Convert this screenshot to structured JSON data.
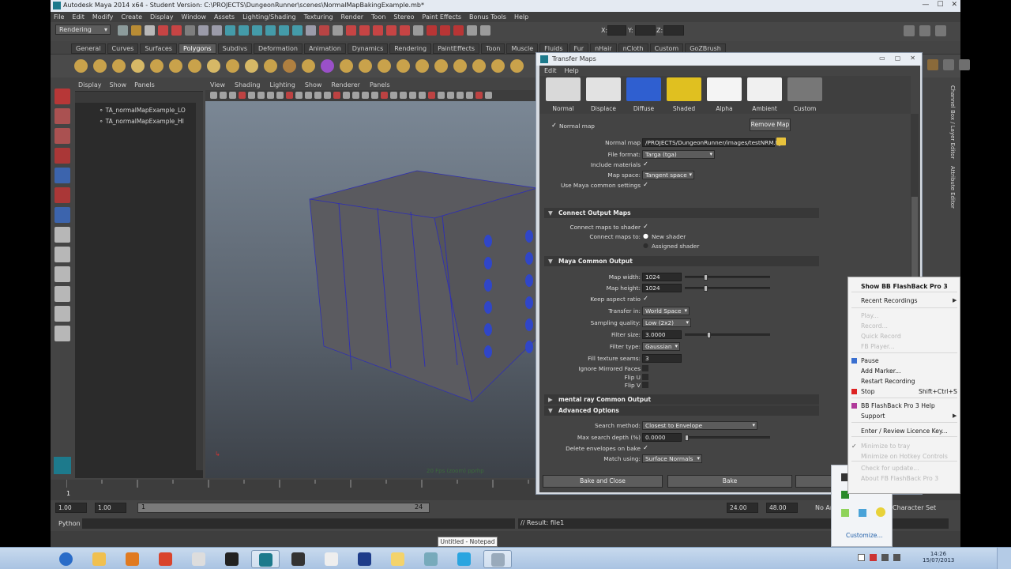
{
  "window": {
    "title": "Autodesk Maya 2014 x64 - Student Version: C:\\PROJECTS\\DungeonRunner\\scenes\\NormalMapBakingExample.mb*",
    "controls": [
      "—",
      "☐",
      "✕"
    ]
  },
  "menubar": [
    "File",
    "Edit",
    "Modify",
    "Create",
    "Display",
    "Window",
    "Assets",
    "Lighting/Shading",
    "Texturing",
    "Render",
    "Toon",
    "Stereo",
    "Paint Effects",
    "Bonus Tools",
    "Help"
  ],
  "statusline": {
    "mode": "Rendering",
    "x_label": "X:",
    "y_label": "Y:",
    "z_label": "Z:"
  },
  "shelf_tabs": [
    "General",
    "Curves",
    "Surfaces",
    "Polygons",
    "Subdivs",
    "Deformation",
    "Animation",
    "Dynamics",
    "Rendering",
    "PaintEffects",
    "Toon",
    "Muscle",
    "Fluids",
    "Fur",
    "nHair",
    "nCloth",
    "Custom",
    "GoZBrush"
  ],
  "shelf_active": "Polygons",
  "outliner": {
    "menu": [
      "Display",
      "Show",
      "Panels"
    ],
    "items": [
      "TA_normalMapExample_LO",
      "TA_normalMapExample_HI"
    ]
  },
  "viewport": {
    "menu": [
      "View",
      "Shading",
      "Lighting",
      "Show",
      "Renderer",
      "Panels"
    ],
    "hud": "20 Fps (zoom) pprhp",
    "colors": {
      "cube_face": "#5b5b60",
      "cube_top": "#5a5a5f",
      "edge": "#3030b0",
      "stud": "#3046c8"
    }
  },
  "right_strip": [
    "Channel Box / Layer Editor",
    "Attribute Editor"
  ],
  "timeline": {
    "tick_start": "1",
    "tick_end": "24"
  },
  "range": {
    "start": "1.00",
    "start2": "1.00",
    "range_start": "1",
    "range_end": "24",
    "end": "24.00",
    "end2": "48.00",
    "anim_layer": "No Anim Layer",
    "char_set": "Character Set"
  },
  "command": {
    "label": "Python",
    "result": "// Result: file1"
  },
  "transfer_maps": {
    "title": "Transfer Maps",
    "menu": [
      "Edit",
      "Help"
    ],
    "thumbs": [
      {
        "label": "Normal",
        "color": "#d9d9d9"
      },
      {
        "label": "Displace",
        "color": "#e2e2e2"
      },
      {
        "label": "Diffuse",
        "color": "#2f5fd0"
      },
      {
        "label": "Shaded",
        "color": "#e0c020"
      },
      {
        "label": "Alpha",
        "color": "#f4f4f4"
      },
      {
        "label": "Ambient",
        "color": "#f0f0f0"
      },
      {
        "label": "Custom",
        "color": "#777"
      }
    ],
    "normal_map": {
      "checkbox_label": "Normal map",
      "remove_button": "Remove Map",
      "path_label": "Normal map",
      "path": "/PROJECTS/DungeonRunner/images/testNRM.tga",
      "format_label": "File format:",
      "format": "Targa (tga)",
      "include_materials": "Include materials",
      "map_space_label": "Map space:",
      "map_space": "Tangent space",
      "use_common": "Use Maya common settings"
    },
    "connect": {
      "section": "Connect Output Maps",
      "connect_to_shader": "Connect maps to shader",
      "connect_to_label": "Connect maps to:",
      "new_shader": "New shader",
      "assigned_shader": "Assigned shader"
    },
    "common": {
      "section": "Maya Common Output",
      "width_label": "Map width:",
      "width": "1024",
      "height_label": "Map height:",
      "height": "1024",
      "keep_aspect": "Keep aspect ratio",
      "transfer_in_label": "Transfer in:",
      "transfer_in": "World Space",
      "sampling_label": "Sampling quality:",
      "sampling": "Low (2x2)",
      "filter_size_label": "Filter size:",
      "filter_size": "3.0000",
      "filter_type_label": "Filter type:",
      "filter_type": "Gaussian",
      "fill_label": "Fill texture seams:",
      "fill": "3",
      "ignore_mirrored": "Ignore Mirrored Faces",
      "flip_u": "Flip U",
      "flip_v": "Flip V"
    },
    "mental_ray": {
      "section": "mental ray Common Output"
    },
    "advanced": {
      "section": "Advanced Options",
      "search_label": "Search method:",
      "search": "Closest to Envelope",
      "depth_label": "Max search depth (%)",
      "depth": "0.0000",
      "delete_env": "Delete envelopes on bake",
      "match_label": "Match using:",
      "match": "Surface Normals"
    },
    "buttons": [
      "Bake and Close",
      "Bake",
      "Close"
    ]
  },
  "context_menu": {
    "items": [
      {
        "text": "Show BB FlashBack Pro 3",
        "bold": true,
        "enabled": true
      },
      {
        "text": "Recent Recordings",
        "enabled": true,
        "sub": true
      },
      {
        "text": "Play...",
        "enabled": false
      },
      {
        "text": "Record...",
        "enabled": false
      },
      {
        "text": "Quick Record",
        "enabled": false
      },
      {
        "text": "FB Player...",
        "enabled": false
      },
      {
        "text": "Pause",
        "enabled": true,
        "icon": "pause"
      },
      {
        "text": "Add Marker...",
        "enabled": true
      },
      {
        "text": "Restart Recording",
        "enabled": true
      },
      {
        "text": "Stop",
        "enabled": true,
        "shortcut": "Shift+Ctrl+S",
        "icon": "stop"
      },
      {
        "text": "BB FlashBack Pro 3 Help",
        "enabled": true,
        "icon": "help"
      },
      {
        "text": "Support",
        "enabled": true,
        "sub": true
      },
      {
        "text": "Enter / Review Licence Key...",
        "enabled": true
      },
      {
        "text": "Minimize to tray",
        "enabled": false,
        "checked": true
      },
      {
        "text": "Minimize on Hotkey Controls",
        "enabled": false
      },
      {
        "text": "Check for update...",
        "enabled": false
      },
      {
        "text": "About FB FlashBack Pro 3",
        "enabled": false
      }
    ]
  },
  "tray_popup": {
    "customize": "Customize..."
  },
  "taskbar": {
    "tooltip": "Untitled - Notepad",
    "clock_time": "14:26",
    "clock_date": "15/07/2013",
    "buttons": [
      "start-orb",
      "explorer",
      "media-player",
      "chrome",
      "alien-app",
      "udk",
      "maya",
      "steam",
      "zbrush",
      "photoshop",
      "folder",
      "mudbox",
      "skype",
      "notepad"
    ]
  }
}
